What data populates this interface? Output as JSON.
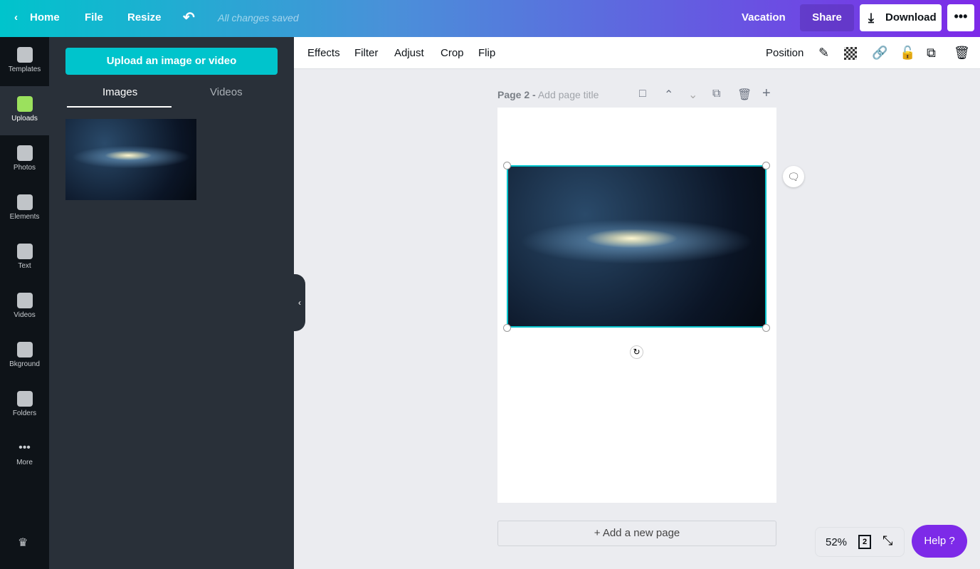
{
  "topbar": {
    "home": "Home",
    "file": "File",
    "resize": "Resize",
    "status": "All changes saved",
    "title": "Vacation",
    "share": "Share",
    "download": "Download",
    "more": "•••"
  },
  "rail": [
    {
      "label": "Templates"
    },
    {
      "label": "Uploads"
    },
    {
      "label": "Photos"
    },
    {
      "label": "Elements"
    },
    {
      "label": "Text"
    },
    {
      "label": "Videos"
    },
    {
      "label": "Bkground"
    },
    {
      "label": "Folders"
    },
    {
      "label": "More"
    }
  ],
  "panel": {
    "upload": "Upload an image or video",
    "tabs": [
      "Images",
      "Videos"
    ]
  },
  "toolbar": {
    "items": [
      "Effects",
      "Filter",
      "Adjust",
      "Crop",
      "Flip"
    ],
    "position": "Position"
  },
  "page": {
    "label": "Page 2 -",
    "title_placeholder": "Add page title",
    "add_page": "+ Add a new page"
  },
  "footer": {
    "zoom": "52%",
    "pages": "2",
    "help": "Help ?"
  },
  "colors": {
    "accent": "#00c4cc",
    "brand": "#7d2ae8"
  }
}
